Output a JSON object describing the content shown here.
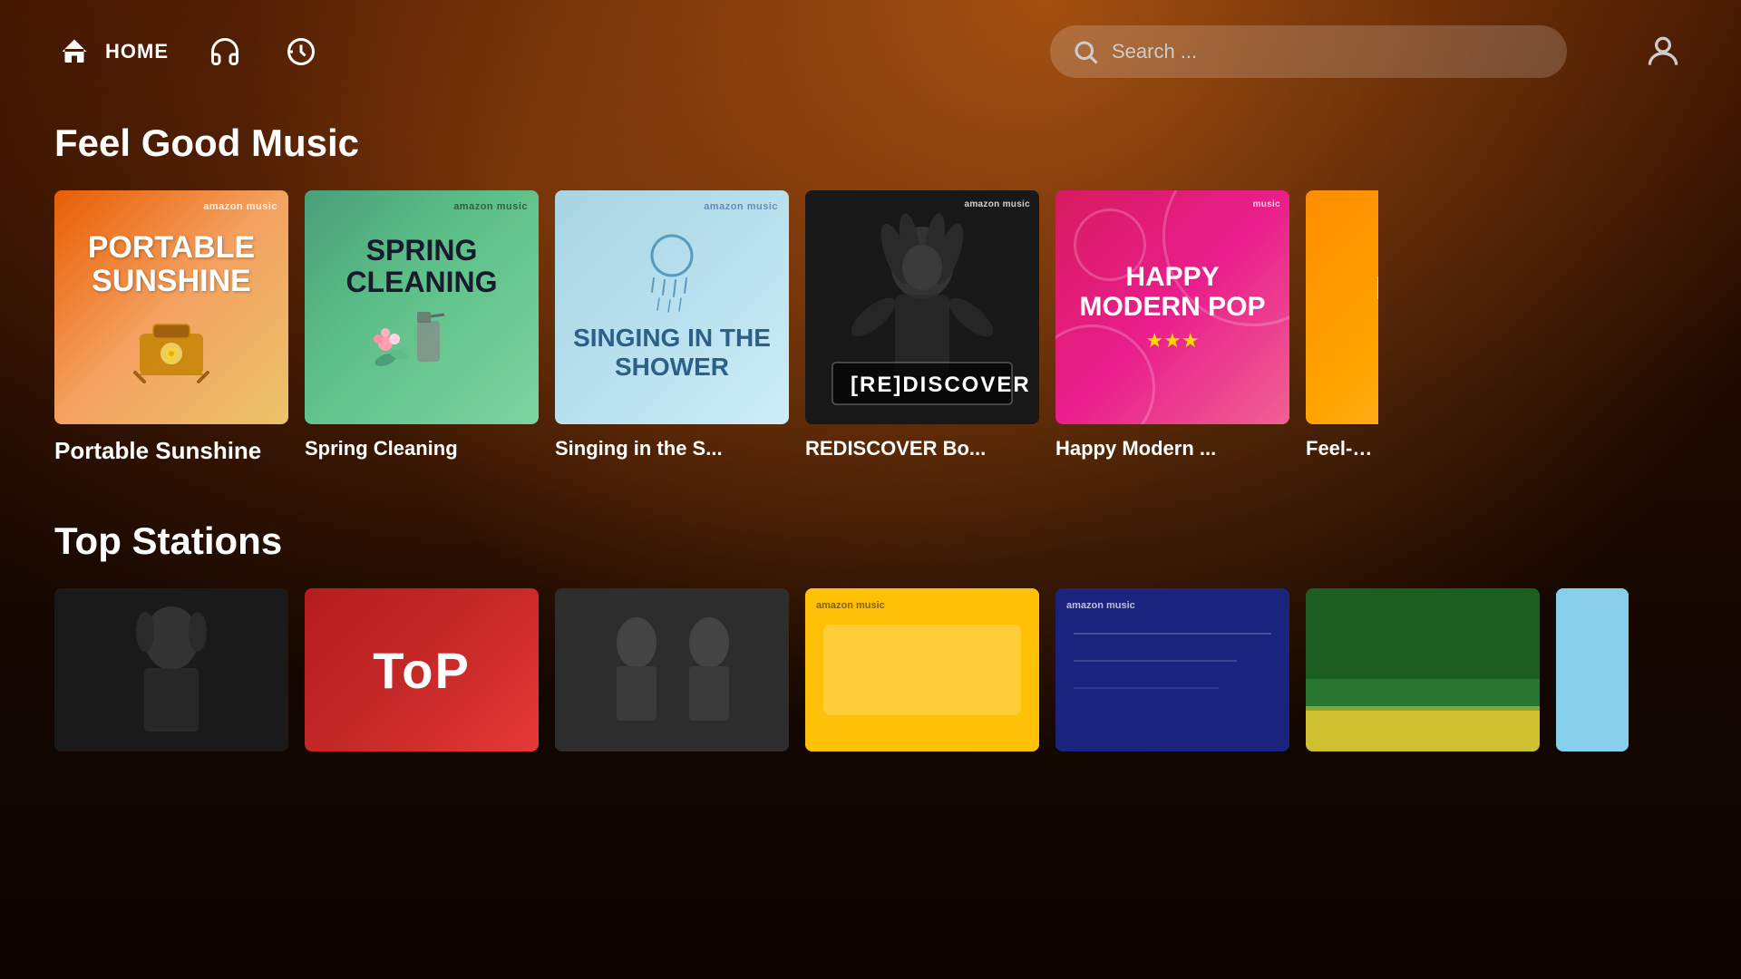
{
  "header": {
    "home_label": "HOME",
    "search_placeholder": "Search ...",
    "nav": {
      "home": "home",
      "headphones": "headphones",
      "history": "history"
    }
  },
  "sections": {
    "feel_good": {
      "title": "Feel Good Music",
      "cards": [
        {
          "id": "portable-sunshine",
          "title": "Portable Sunshine",
          "title_display": "PORTABLE SUNSHINE",
          "label": "Portable Sunshine",
          "bg": "orange"
        },
        {
          "id": "spring-cleaning",
          "title": "Spring Cleaning",
          "title_display": "SPRING CLEANING",
          "label": "Spring Cleaning",
          "bg": "green"
        },
        {
          "id": "singing-shower",
          "title": "Singing in the Shower",
          "title_display": "SINGING IN THE SHOWER",
          "label": "Singing in the S...",
          "bg": "blue"
        },
        {
          "id": "rediscover",
          "title": "REDISCOVER Bob...",
          "title_display": "[RE]DISCOVER",
          "label": "REDISCOVER Bo...",
          "bg": "dark"
        },
        {
          "id": "happy-modern-pop",
          "title": "Happy Modern Pop",
          "title_display": "HAPPY MODERN POP",
          "label": "Happy Modern ...",
          "bg": "pink"
        },
        {
          "id": "feel-good-country",
          "title": "Feel-Good Country",
          "title_display": "FEEL-COU",
          "label": "Feel-Go...",
          "bg": "orange2"
        }
      ]
    },
    "top_stations": {
      "title": "Top Stations",
      "cards": [
        {
          "id": "station-1",
          "label": "",
          "bg": "dark1"
        },
        {
          "id": "station-2",
          "label": "ToP",
          "bg": "red"
        },
        {
          "id": "station-3",
          "label": "",
          "bg": "dark2"
        },
        {
          "id": "station-4",
          "label": "",
          "bg": "yellow"
        },
        {
          "id": "station-5",
          "label": "",
          "bg": "navy"
        },
        {
          "id": "station-6",
          "label": "",
          "bg": "green2"
        },
        {
          "id": "station-7",
          "label": "",
          "bg": "lightblue"
        }
      ]
    }
  },
  "brand": {
    "amazon_music": "amazon music",
    "music": "music"
  },
  "stars": "★★★",
  "colors": {
    "accent": "#e85d04",
    "bg_dark": "#1a0800",
    "header_bg": "transparent",
    "search_bg": "rgba(255,255,255,0.18)"
  }
}
